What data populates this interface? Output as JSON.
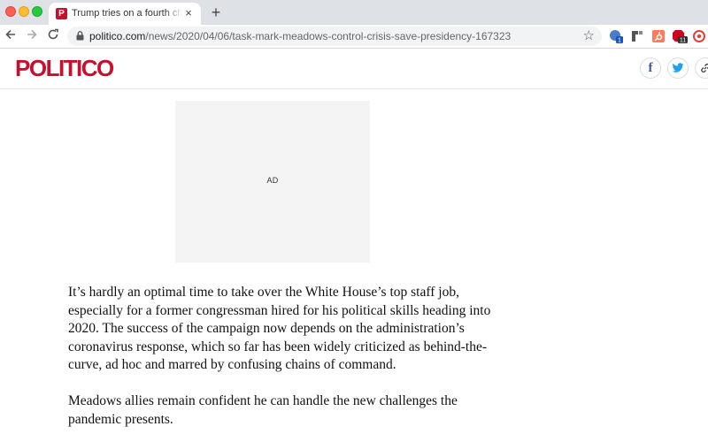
{
  "browser": {
    "tab_title": "Trump tries on a fourth chief of staff",
    "tab_favicon_letter": "P",
    "new_tab_symbol": "+",
    "close_symbol": "×",
    "url_domain": "politico.com",
    "url_path": "/news/2020/04/06/task-mark-meadows-control-crisis-save-presidency-167323",
    "extensions": [
      {
        "name": "extension-1-icon",
        "badge": "1"
      },
      {
        "name": "extension-2-icon"
      },
      {
        "name": "hubspot-icon"
      },
      {
        "name": "adblock-icon",
        "badge": "11"
      },
      {
        "name": "extension-5-icon"
      }
    ]
  },
  "site": {
    "logo": "POLITICO",
    "brand_color": "#c8102e",
    "share": {
      "facebook": "f"
    }
  },
  "ad": {
    "label": "AD"
  },
  "article": {
    "paragraphs": [
      {
        "lines": [
          "It’s hardly an optimal time to take over the White House’s top staff job,",
          "especially for a former congressman hired for his political skills heading into",
          "2020. The success of the campaign now depends on the administration’s",
          "coronavirus response, which so far has been widely criticized as behind-the-",
          "curve, ad hoc and marred by confusing chains of command."
        ]
      },
      {
        "lines": [
          "Meadows allies remain confident he can handle the new challenges the",
          "pandemic presents."
        ]
      }
    ]
  }
}
